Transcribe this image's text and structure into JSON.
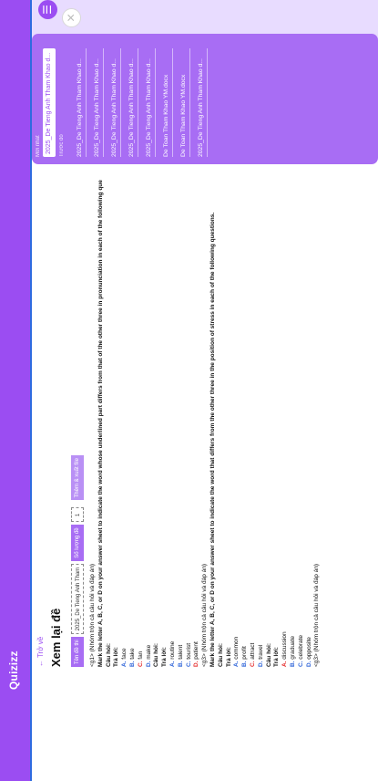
{
  "app": {
    "brand": "Quizizz"
  },
  "page": {
    "back_label": "← Trở về",
    "title": "Xem lại đề"
  },
  "controls": {
    "tab_label": "Tên đề thi",
    "file_name": "2025_De Tieng Anh Tham",
    "count_label": "Số lượng đề",
    "count_value": "1",
    "download_label": "Thêm & xuất file"
  },
  "content": {
    "lines": [
      {
        "text": "<g1> (Nhóm trộn cả câu hỏi và đáp án)",
        "style": ""
      },
      {
        "text": "Mark the letter A, B, C, or D on your answer sheet to indicate the word whose underlined part differs from that of the other three in pronunciation in each of the following que",
        "style": "bold"
      },
      {
        "text": "Câu hỏi:",
        "style": "bold"
      },
      {
        "text": "Trả lời:",
        "style": "bold"
      },
      {
        "text": "A. face",
        "prefix": "A.",
        "body": " face",
        "style": "opt-blue"
      },
      {
        "text": "B. take",
        "prefix": "B.",
        "body": " take",
        "style": "opt-blue"
      },
      {
        "text": "C. fan",
        "prefix": "C.",
        "body": " fan",
        "style": "opt-red"
      },
      {
        "text": "D. make",
        "prefix": "D.",
        "body": " make",
        "style": "opt-blue"
      },
      {
        "text": "Câu hỏi:",
        "style": "bold"
      },
      {
        "text": "Trả lời:",
        "style": "bold"
      },
      {
        "text": "A. routine",
        "prefix": "A.",
        "body": " routine",
        "style": "opt-blue"
      },
      {
        "text": "B. talent",
        "prefix": "B.",
        "body": " talent",
        "style": "opt-blue"
      },
      {
        "text": "C. tourist",
        "prefix": "C.",
        "body": " tourist",
        "style": "opt-blue"
      },
      {
        "text": "D. patient",
        "prefix": "D.",
        "body": " patient",
        "style": "opt-red"
      },
      {
        "text": "<g3> (Nhóm trộn cả câu hỏi và đáp án)",
        "style": ""
      },
      {
        "text": "Mark the letter A, B, C, or D on your answer sheet to indicate the word that differs from the other three in the position of stress in each of the following questions.",
        "style": "bold"
      },
      {
        "text": "Câu hỏi:",
        "style": "bold"
      },
      {
        "text": "Trả lời:",
        "style": "bold"
      },
      {
        "text": "A. common",
        "prefix": "A.",
        "body": " common",
        "style": "opt-blue"
      },
      {
        "text": "B. profit",
        "prefix": "B.",
        "body": " profit",
        "style": "opt-blue"
      },
      {
        "text": "C. attract",
        "prefix": "C.",
        "body": " attract",
        "style": "opt-red"
      },
      {
        "text": "D. travel",
        "prefix": "D.",
        "body": " travel",
        "style": "opt-blue"
      },
      {
        "text": "Câu hỏi:",
        "style": "bold"
      },
      {
        "text": "Trả lời:",
        "style": "bold"
      },
      {
        "text": "A. discussion",
        "prefix": "A.",
        "body": " discussion",
        "style": "opt-red"
      },
      {
        "text": "B. graduate",
        "prefix": "B.",
        "body": " graduate",
        "style": "opt-blue"
      },
      {
        "text": "C. celebrate",
        "prefix": "C.",
        "body": " celebrate",
        "style": "opt-blue"
      },
      {
        "text": "D. opposite",
        "prefix": "D.",
        "body": " opposite",
        "style": "opt-blue"
      },
      {
        "text": "<g3> (Nhóm trộn cả câu hỏi và đáp án)",
        "style": ""
      }
    ]
  },
  "sidebar": {
    "new_label": "Mới nhất",
    "search_value": "2025_De Tieng Anh Tham Khao d...",
    "previous_label": "Trước đó",
    "documents": [
      "2025_De Tieng Anh Tham Khao d...",
      "2025_De Tieng Anh Tham Khao d...",
      "2025_De Tieng Anh Tham Khao d...",
      "2025_De Tieng Anh Tham Khao d...",
      "2025_De Tieng Anh Tham Khao d...",
      "De Toan Tham Khao YM.docx",
      "De Toan Tham Khao YM.docx",
      "2025_De Tieng Anh Tham Khao d..."
    ]
  },
  "colors": {
    "accent": "#9b4df2",
    "sidebar": "#a86df4",
    "answer_red": "#e52b2b",
    "option_blue": "#2c62d8",
    "background": "#e8dcff"
  }
}
